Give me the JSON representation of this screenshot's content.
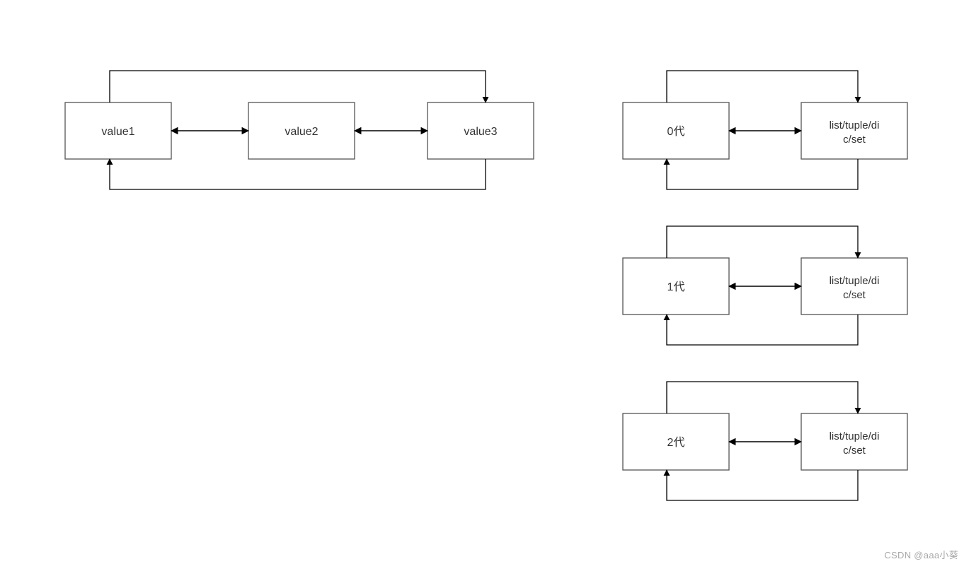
{
  "left": {
    "boxes": [
      "value1",
      "value2",
      "value3"
    ]
  },
  "right": [
    {
      "left": "0代",
      "right_line1": "list/tuple/di",
      "right_line2": "c/set"
    },
    {
      "left": "1代",
      "right_line1": "list/tuple/di",
      "right_line2": "c/set"
    },
    {
      "left": "2代",
      "right_line1": "list/tuple/di",
      "right_line2": "c/set"
    }
  ],
  "watermark": "CSDN @aaa小葵"
}
